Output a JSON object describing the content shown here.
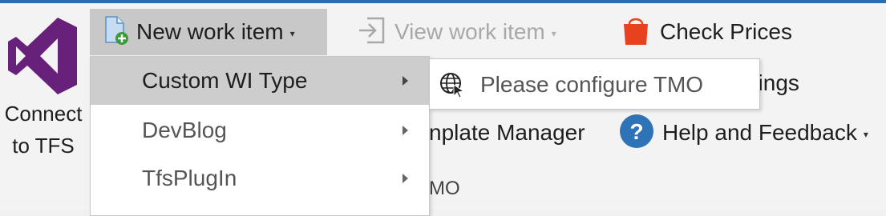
{
  "ribbon": {
    "connect": {
      "label_line1": "Connect",
      "label_line2": "to TFS",
      "icon": "visual-studio-logo"
    },
    "new_work_item": {
      "label": "New work item",
      "icon": "new-document-icon"
    },
    "view_work_item": {
      "label": "View work item",
      "icon": "open-item-icon",
      "enabled": false
    },
    "check_prices": {
      "label": "Check Prices",
      "icon": "shopping-bag-icon"
    },
    "settings_partial": "ttings",
    "template_manager_partial": "nplate Manager",
    "help_feedback": {
      "label": "Help and Feedback",
      "icon": "help-circle-icon"
    },
    "group_label_partial": "MO"
  },
  "menu": {
    "items": [
      {
        "label": "Custom WI Type",
        "has_submenu": true,
        "active": true
      },
      {
        "label": "DevBlog",
        "has_submenu": true,
        "active": false
      },
      {
        "label": "TfsPlugIn",
        "has_submenu": true,
        "active": false
      }
    ]
  },
  "submenu": {
    "items": [
      {
        "label": "Please configure TMO",
        "icon": "globe-cursor-icon"
      }
    ]
  },
  "colors": {
    "accent_topline": "#2b6cb0",
    "vs_purple": "#68217a",
    "office_red": "#e8411e",
    "help_blue": "#2f73b7",
    "hover_gray": "#c8c8c8"
  }
}
